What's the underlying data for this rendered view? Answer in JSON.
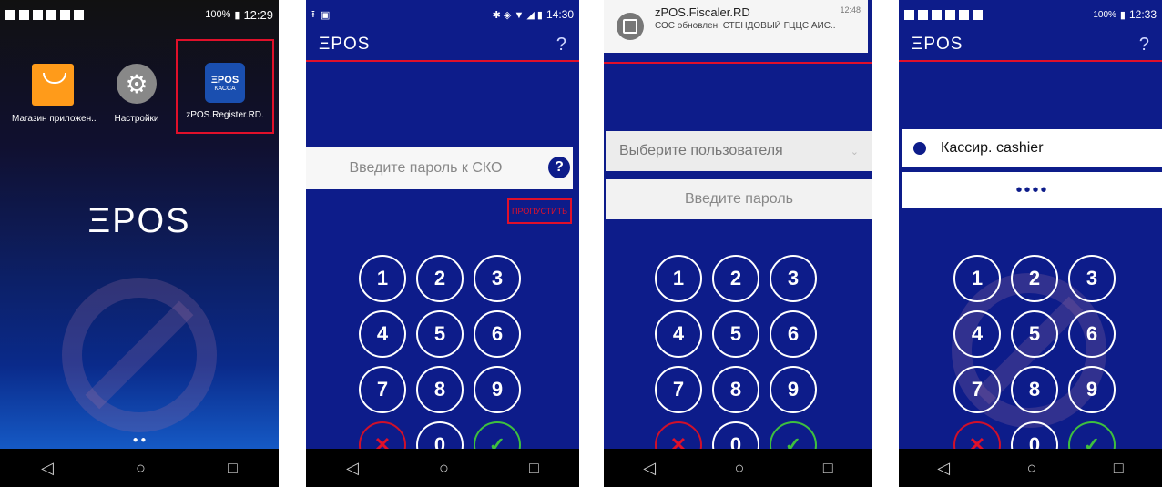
{
  "screen1": {
    "time": "12:29",
    "battery": "100%",
    "apps": [
      {
        "label": "Магазин приложен..",
        "icon": "shopping-bag-icon"
      },
      {
        "label": "Настройки",
        "icon": "settings-gear-icon"
      },
      {
        "label": "zPOS.Register.RD.",
        "icon": "zpos-kassa-icon",
        "icon_line1": "ΞPOS",
        "icon_line2": "КАССА"
      }
    ],
    "logo": "ΞPOS"
  },
  "screen2": {
    "time": "14:30",
    "logo": "ΞPOS",
    "help": "?",
    "password_placeholder": "Введите пароль к СКО",
    "skip_label": "ПРОПУСТИТЬ",
    "keys": [
      "1",
      "2",
      "3",
      "4",
      "5",
      "6",
      "7",
      "8",
      "9",
      "✕",
      "0",
      "✓"
    ]
  },
  "screen3": {
    "notification_title": "zPOS.Fiscaler.RD",
    "notification_time": "12:48",
    "notification_text": "СОС обновлен: СТЕНДОВЫЙ ГЦЦС АИС..",
    "user_select_placeholder": "Выберите пользователя",
    "password_placeholder": "Введите пароль",
    "keys": [
      "1",
      "2",
      "3",
      "4",
      "5",
      "6",
      "7",
      "8",
      "9",
      "✕",
      "0",
      "✓"
    ]
  },
  "screen4": {
    "time": "12:33",
    "battery": "100%",
    "logo": "ΞPOS",
    "help": "?",
    "user_label": "Кассир. cashier",
    "password_dots": "••••",
    "keys": [
      "1",
      "2",
      "3",
      "4",
      "5",
      "6",
      "7",
      "8",
      "9",
      "✕",
      "0",
      "✓"
    ]
  },
  "nav": {
    "back": "◁",
    "home": "○",
    "recent": "□"
  }
}
